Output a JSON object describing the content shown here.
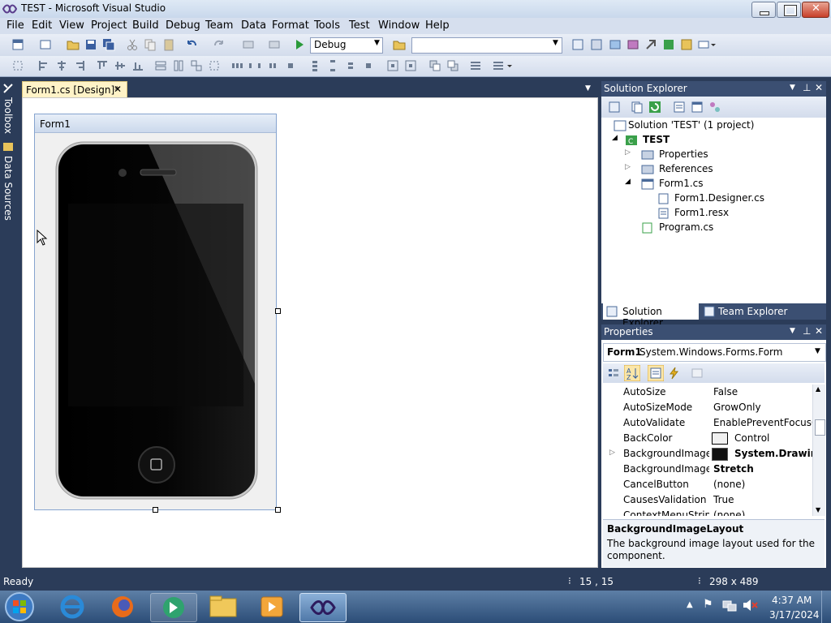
{
  "window": {
    "title": "TEST - Microsoft Visual Studio"
  },
  "menu": [
    "File",
    "Edit",
    "View",
    "Project",
    "Build",
    "Debug",
    "Team",
    "Data",
    "Format",
    "Tools",
    "Test",
    "Window",
    "Help"
  ],
  "toolbar": {
    "config_value": "Debug",
    "platform_value": ""
  },
  "side_tabs": {
    "toolbox": "Toolbox",
    "data_sources": "Data Sources"
  },
  "document": {
    "tab_label": "Form1.cs [Design]*",
    "form_caption": "Form1"
  },
  "solution_explorer": {
    "title": "Solution Explorer",
    "items": [
      "Solution 'TEST' (1 project)",
      "TEST",
      "Properties",
      "References",
      "Form1.cs",
      "Form1.Designer.cs",
      "Form1.resx",
      "Program.cs"
    ],
    "tabs": [
      "Solution Explorer",
      "Team Explorer"
    ]
  },
  "properties": {
    "title": "Properties",
    "object_name": "Form1",
    "object_type": "System.Windows.Forms.Form",
    "rows": [
      {
        "name": "AutoSize",
        "value": "False"
      },
      {
        "name": "AutoSizeMode",
        "value": "GrowOnly"
      },
      {
        "name": "AutoValidate",
        "value": "EnablePreventFocusChange"
      },
      {
        "name": "BackColor",
        "value": "Control"
      },
      {
        "name": "BackgroundImage",
        "value": "System.Drawing.Bitmap"
      },
      {
        "name": "BackgroundImageLayout",
        "value": "Stretch"
      },
      {
        "name": "CancelButton",
        "value": "(none)"
      },
      {
        "name": "CausesValidation",
        "value": "True"
      },
      {
        "name": "ContextMenuStrip",
        "value": "(none)"
      }
    ],
    "desc_title": "BackgroundImageLayout",
    "desc_text": "The background image layout used for the component."
  },
  "status": {
    "ready": "Ready",
    "position": "15 , 15",
    "size": "298 x 489"
  },
  "taskbar": {
    "time": "4:37 AM",
    "date": "3/17/2024"
  }
}
